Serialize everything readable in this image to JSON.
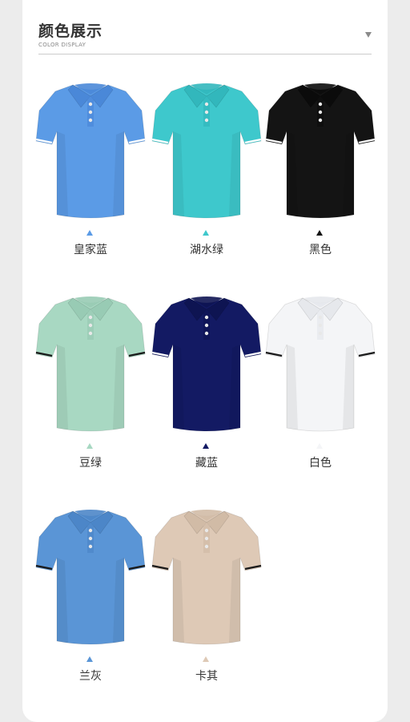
{
  "header": {
    "title": "颜色展示",
    "subtitle": "COLOR DISPLAY",
    "arrow_icon": "triangle-down-icon"
  },
  "colors": [
    {
      "label": "皇家蓝",
      "hex": "#5b9be6",
      "collar": "#4a88d8",
      "trim": "#ffffff"
    },
    {
      "label": "湖水绿",
      "hex": "#3ec8cc",
      "collar": "#32b7bc",
      "trim": "#ffffff"
    },
    {
      "label": "黑色",
      "hex": "#141414",
      "collar": "#0b0b0b",
      "trim": "#ffffff"
    },
    {
      "label": "豆绿",
      "hex": "#a8d8c2",
      "collar": "#98cbb4",
      "trim": "#1a1a1a"
    },
    {
      "label": "藏蓝",
      "hex": "#131a63",
      "collar": "#0e1452",
      "trim": "#ffffff"
    },
    {
      "label": "白色",
      "hex": "#f4f5f7",
      "collar": "#e6e8ec",
      "trim": "#1a1a1a"
    },
    {
      "label": "兰灰",
      "hex": "#5a95d6",
      "collar": "#4c86c8",
      "trim": "#1a1a1a"
    },
    {
      "label": "卡其",
      "hex": "#dec9b6",
      "collar": "#d1bba6",
      "trim": "#1a1a1a"
    }
  ]
}
